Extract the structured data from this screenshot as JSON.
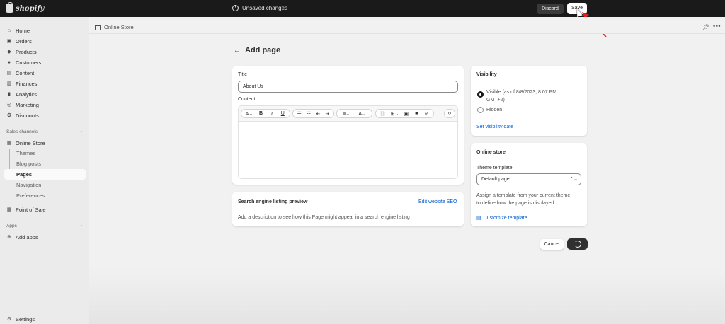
{
  "topbar": {
    "brand": "shopify",
    "status": "Unsaved changes",
    "discard_label": "Discard",
    "save_label": "Save"
  },
  "sidebar": {
    "items": [
      {
        "label": "Home",
        "icon": "home-icon"
      },
      {
        "label": "Orders",
        "icon": "orders-icon"
      },
      {
        "label": "Products",
        "icon": "tag-icon"
      },
      {
        "label": "Customers",
        "icon": "person-icon"
      },
      {
        "label": "Content",
        "icon": "content-icon"
      },
      {
        "label": "Finances",
        "icon": "bank-icon"
      },
      {
        "label": "Analytics",
        "icon": "chart-icon"
      },
      {
        "label": "Marketing",
        "icon": "target-icon"
      },
      {
        "label": "Discounts",
        "icon": "discount-icon"
      }
    ],
    "sales_channels_header": "Sales channels",
    "online_store": "Online Store",
    "online_store_sub": [
      "Themes",
      "Blog posts",
      "Pages",
      "Navigation",
      "Preferences"
    ],
    "point_of_sale": "Point of Sale",
    "apps_header": "Apps",
    "add_apps": "Add apps",
    "settings": "Settings"
  },
  "context": {
    "title": "Online Store"
  },
  "page": {
    "title": "Add page",
    "title_label": "Title",
    "title_value": "About Us",
    "content_label": "Content",
    "seo": {
      "heading": "Search engine listing preview",
      "edit_link": "Edit website SEO",
      "description": "Add a description to see how this Page might appear in a search engine listing"
    },
    "visibility": {
      "heading": "Visibility",
      "visible_label": "Visible (as of 8/8/2023, 8:07 PM GMT+2)",
      "visible_line1": "Visible (as of 8/8/2023, 8:07 PM",
      "visible_line2": "GMT+2)",
      "hidden_label": "Hidden",
      "set_date_link": "Set visibility date"
    },
    "online_store": {
      "heading": "Online store",
      "template_label": "Theme template",
      "template_value": "Default page",
      "help_line1": "Assign a template from your current theme",
      "help_line2": "to define how the page is displayed.",
      "customize_link": "Customize template"
    },
    "cancel_label": "Cancel"
  },
  "colors": {
    "topbar": "#1a1a1a",
    "link": "#005bd3",
    "arrow": "#e02020"
  }
}
